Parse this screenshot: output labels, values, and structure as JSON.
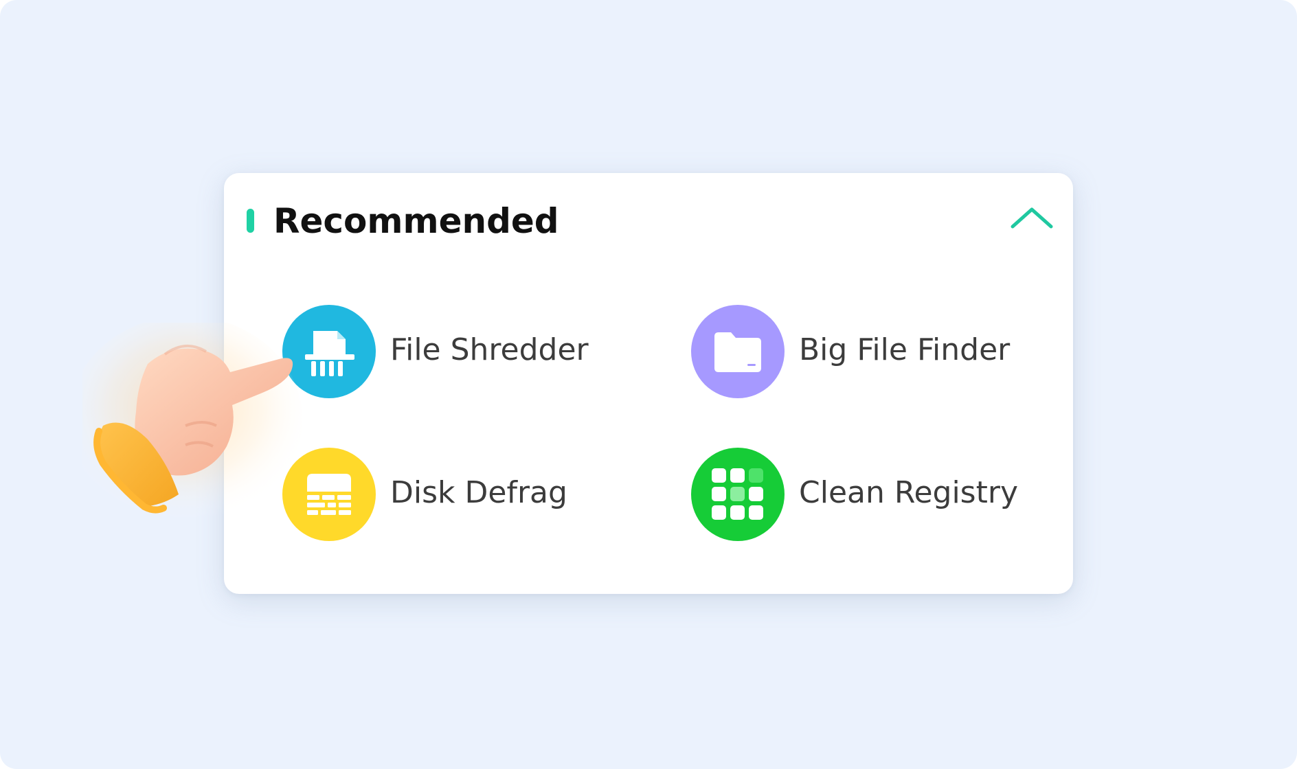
{
  "panel": {
    "title": "Recommended",
    "collapse_icon": "chevron-up-icon",
    "accent_color": "#1fd1a4"
  },
  "items": [
    {
      "label": "File Shredder",
      "icon": "file-shredder-icon",
      "color": "#20b8e0"
    },
    {
      "label": "Big File Finder",
      "icon": "folder-icon",
      "color": "#a699ff"
    },
    {
      "label": "Disk Defrag",
      "icon": "disk-defrag-icon",
      "color": "#ffd92a"
    },
    {
      "label": "Clean Registry",
      "icon": "registry-grid-icon",
      "color": "#16cc37"
    }
  ],
  "pointer": {
    "icon": "pointing-hand-icon"
  }
}
